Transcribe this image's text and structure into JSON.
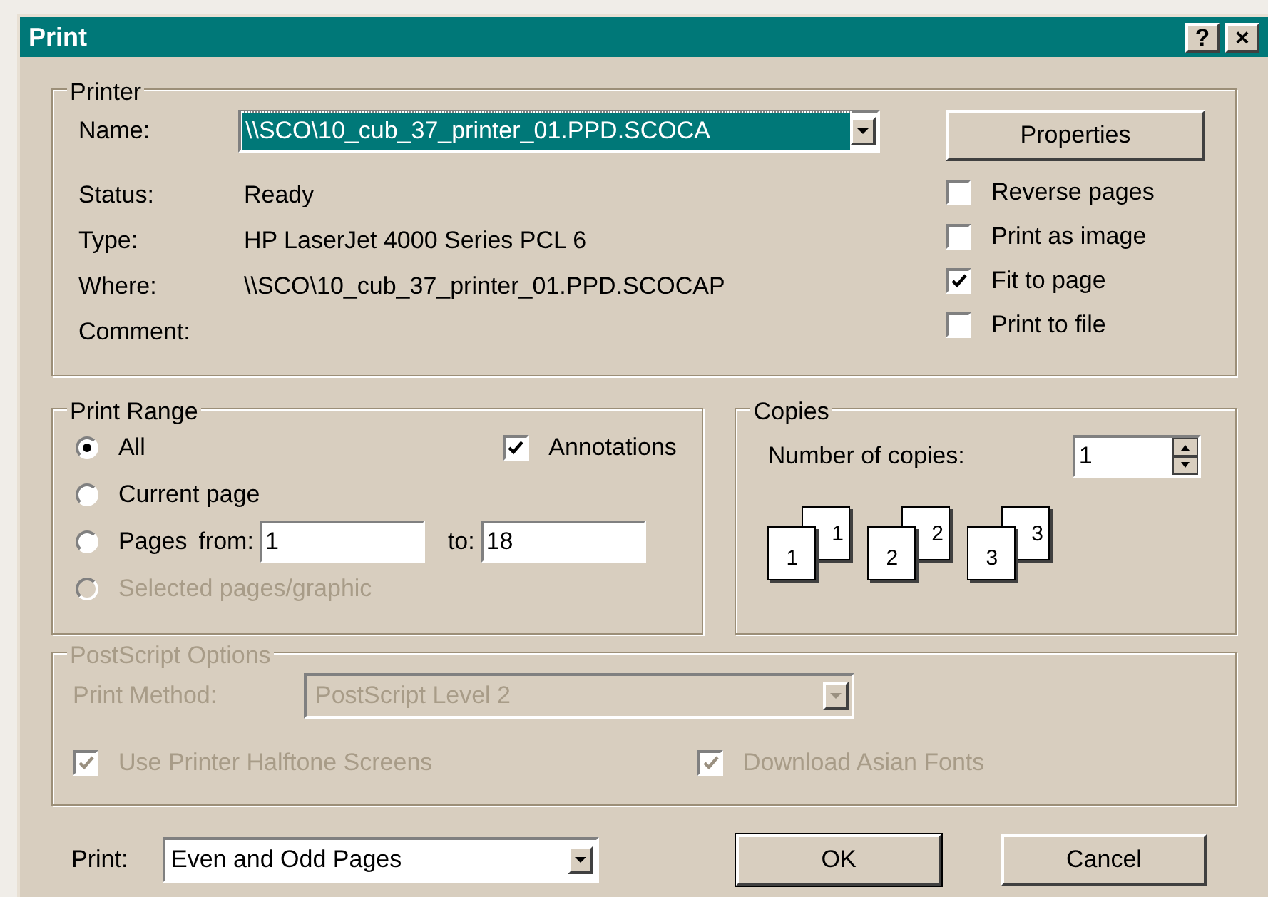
{
  "window": {
    "title": "Print",
    "controls": [
      "?",
      "×"
    ]
  },
  "printer": {
    "legend": "Printer",
    "name_label": "Name:",
    "name_value": "\\\\SCO\\10_cub_37_printer_01.PPD.SCOCA",
    "properties_button": "Properties",
    "info": [
      {
        "label": "Status:",
        "value": "Ready"
      },
      {
        "label": "Type:",
        "value": "HP LaserJet 4000 Series PCL 6"
      },
      {
        "label": "Where:",
        "value": "\\\\SCO\\10_cub_37_printer_01.PPD.SCOCAP"
      },
      {
        "label": "Comment:"
      }
    ],
    "options": [
      {
        "label": "Reverse pages",
        "checked": false
      },
      {
        "label": "Print as image",
        "checked": false
      },
      {
        "label": "Fit to page",
        "checked": true
      },
      {
        "label": "Print to file",
        "checked": false
      }
    ]
  },
  "print_range": {
    "legend": "Print Range",
    "radios": [
      {
        "label": "All",
        "selected": true,
        "disabled": false
      },
      {
        "label": "Current page",
        "selected": false,
        "disabled": false
      },
      {
        "label": "Pages",
        "selected": false,
        "disabled": false
      },
      {
        "label": "Selected pages/graphic",
        "selected": false,
        "disabled": true
      }
    ],
    "annotations": {
      "label": "Annotations",
      "checked": true
    },
    "from_label": "from:",
    "from_value": "1",
    "to_label": "to:",
    "to_value": "18"
  },
  "copies": {
    "legend": "Copies",
    "label": "Number of copies:",
    "value": "1",
    "collate_pages": [
      {
        "front": "1",
        "back": "1"
      },
      {
        "front": "2",
        "back": "2"
      },
      {
        "front": "3",
        "back": "3"
      }
    ]
  },
  "postscript": {
    "legend": "PostScript Options",
    "disabled": true,
    "method_label": "Print Method:",
    "method_value": "PostScript Level 2",
    "options": [
      {
        "label": "Use Printer Halftone Screens",
        "checked": true
      },
      {
        "label": "Download Asian Fonts",
        "checked": true
      }
    ]
  },
  "footer": {
    "print_label": "Print:",
    "print_value": "Even and Odd Pages",
    "ok": "OK",
    "cancel": "Cancel"
  }
}
